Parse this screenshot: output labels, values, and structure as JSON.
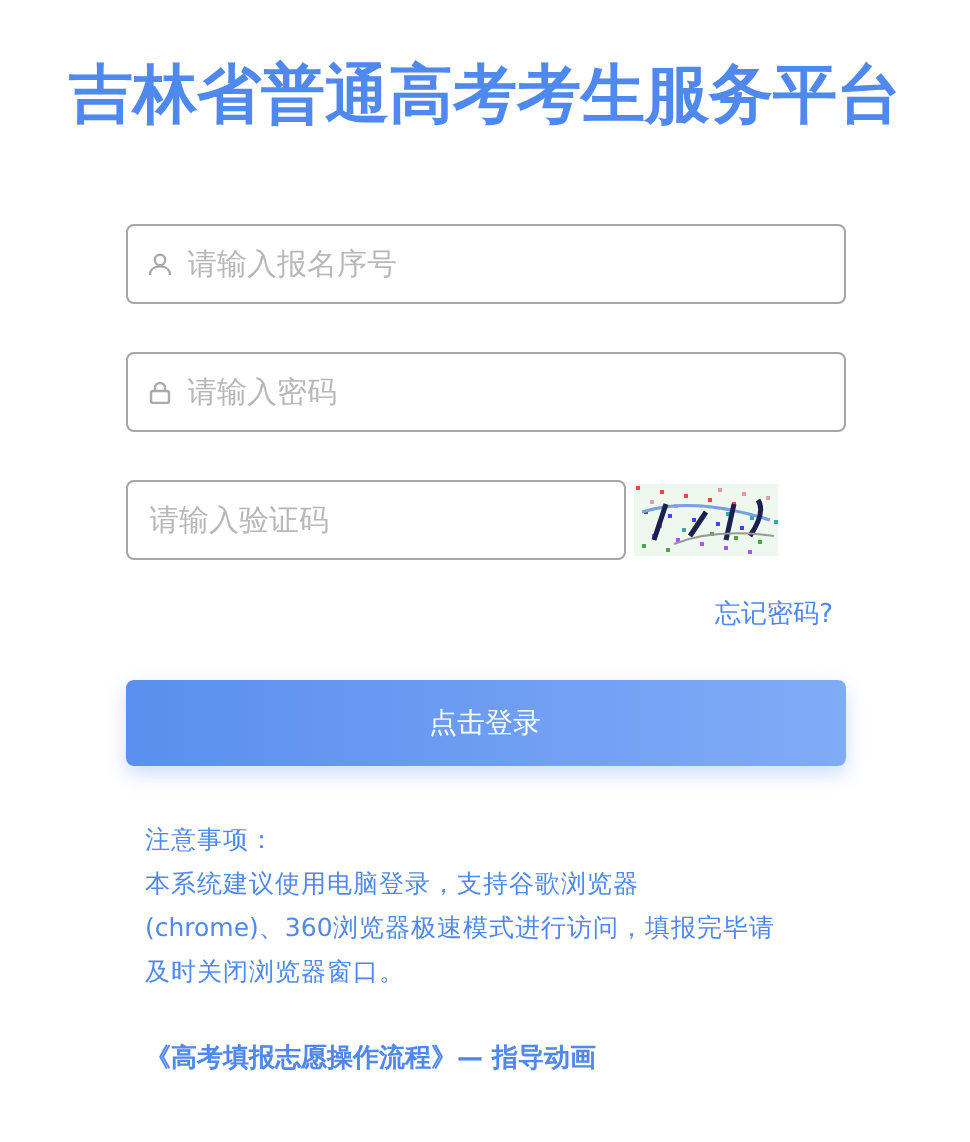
{
  "title": "吉林省普通高考考生服务平台",
  "form": {
    "username": {
      "placeholder": "请输入报名序号"
    },
    "password": {
      "placeholder": "请输入密码"
    },
    "captcha": {
      "placeholder": "请输入验证码"
    },
    "forgot_link": "忘记密码?",
    "submit": "点击登录"
  },
  "notice": {
    "heading": "注意事项：",
    "body_lines": [
      "本系统建议使用电脑登录，支持谷歌浏览器",
      "(chrome)、360浏览器极速模式进行访问，填报完毕请",
      "及时关闭浏览器窗口。"
    ]
  },
  "guide_link": "《高考填报志愿操作流程》— 指导动画"
}
